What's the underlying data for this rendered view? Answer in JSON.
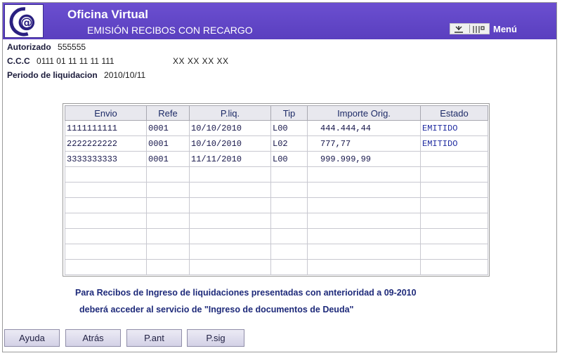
{
  "header": {
    "app_title": "Oficina Virtual",
    "screen_title": "EMISIÓN RECIBOS CON RECARGO",
    "menu_label": "Menú",
    "logo_icon": "at-sign-logo-icon"
  },
  "info": {
    "autorizado_label": "Autorizado",
    "autorizado_value": "555555",
    "ccc_label": "C.C.C",
    "ccc_value": "0111 01 11 11 11 111",
    "ccc_extra": "XX XX XX XX",
    "periodo_label": "Periodo de liquidacion",
    "periodo_value": "2010/10/11"
  },
  "table": {
    "columns": [
      "Envio",
      "Refe",
      "P.liq.",
      "Tip",
      "Importe Orig.",
      "Estado"
    ],
    "rows": [
      [
        "1111111111",
        "0001",
        "10/10/2010",
        "L00",
        "444.444,44",
        "EMITIDO"
      ],
      [
        "2222222222",
        "0001",
        "10/10/2010",
        "L02",
        "777,77",
        "EMITIDO"
      ],
      [
        "3333333333",
        "0001",
        "11/11/2010",
        "L00",
        "999.999,99",
        ""
      ],
      [
        "",
        "",
        "",
        "",
        "",
        ""
      ],
      [
        "",
        "",
        "",
        "",
        "",
        ""
      ],
      [
        "",
        "",
        "",
        "",
        "",
        ""
      ],
      [
        "",
        "",
        "",
        "",
        "",
        ""
      ],
      [
        "",
        "",
        "",
        "",
        "",
        ""
      ],
      [
        "",
        "",
        "",
        "",
        "",
        ""
      ],
      [
        "",
        "",
        "",
        "",
        "",
        ""
      ]
    ]
  },
  "notice": {
    "line1": "Para Recibos de Ingreso de liquidaciones presentadas con anterioridad a  09-2010",
    "line2": "deberá acceder al servicio de \"Ingreso de documentos de Deuda\""
  },
  "buttons": {
    "ayuda": "Ayuda",
    "atras": "Atrás",
    "pant": "P.ant",
    "psig": "P.sig"
  },
  "colors": {
    "header_bg": "#5a3fbf",
    "grid_header_bg": "#e8e8ee",
    "text_dark_blue": "#1e2a7a"
  }
}
